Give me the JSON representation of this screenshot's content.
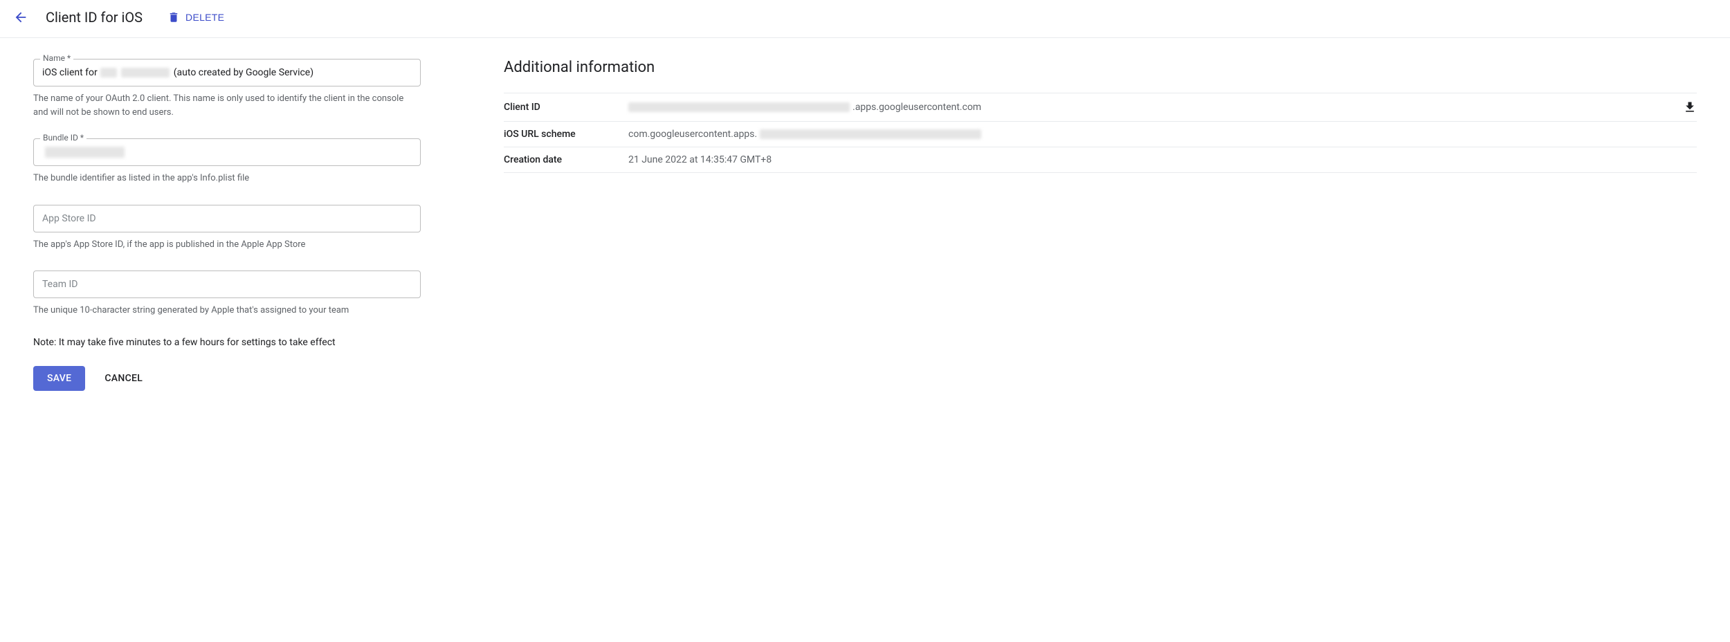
{
  "header": {
    "title": "Client ID for iOS",
    "delete_label": "DELETE"
  },
  "form": {
    "name_label": "Name *",
    "name_prefix": "iOS client for",
    "name_suffix": "(auto created by Google Service)",
    "name_help": "The name of your OAuth 2.0 client. This name is only used to identify the client in the console and will not be shown to end users.",
    "bundle_label": "Bundle ID *",
    "bundle_value": "",
    "bundle_help": "The bundle identifier as listed in the app's Info.plist file",
    "appstore_placeholder": "App Store ID",
    "appstore_help": "The app's App Store ID, if the app is published in the Apple App Store",
    "team_placeholder": "Team ID",
    "team_help": "The unique 10-character string generated by Apple that's assigned to your team",
    "note": "Note: It may take five minutes to a few hours for settings to take effect",
    "save_label": "SAVE",
    "cancel_label": "CANCEL"
  },
  "info": {
    "section_title": "Additional information",
    "client_id_label": "Client ID",
    "client_id_suffix": ".apps.googleusercontent.com",
    "url_scheme_label": "iOS URL scheme",
    "url_scheme_prefix": "com.googleusercontent.apps.",
    "creation_label": "Creation date",
    "creation_value": "21 June 2022 at 14:35:47 GMT+8"
  }
}
